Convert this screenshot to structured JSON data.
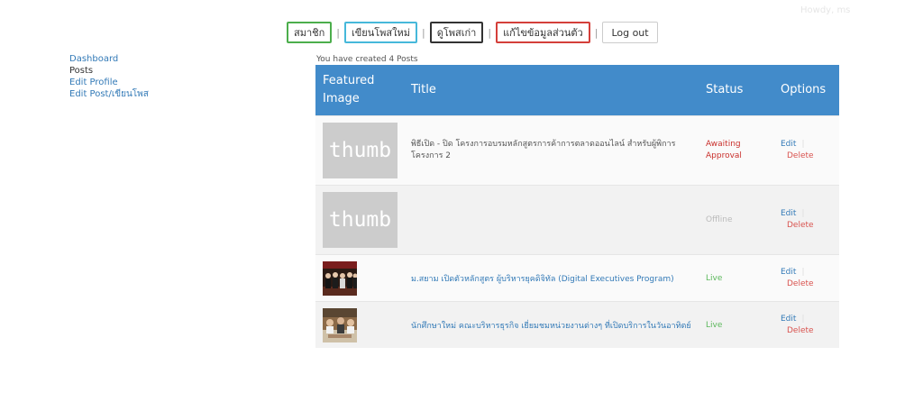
{
  "header": {
    "howdy": "Howdy, ms"
  },
  "topnav": {
    "member": "สมาชิก",
    "new_post": "เขียนโพสใหม่",
    "old_posts": "ดูโพสเก่า",
    "edit_profile": "แก้ไขข้อมูลส่วนตัว",
    "logout": "Log out",
    "separator": "|"
  },
  "sidebar": {
    "dashboard": "Dashboard",
    "posts": "Posts",
    "edit_profile": "Edit Profile",
    "edit_post": "Edit Post/เขียนโพส"
  },
  "posts": {
    "count_text": "You have created 4 Posts",
    "headers": {
      "featured_line1": "Featured",
      "featured_line2": "Image",
      "title": "Title",
      "status": "Status",
      "options": "Options"
    },
    "rows": [
      {
        "thumb": "thumb",
        "title": "พิธีเปิด - ปิด โครงการอบรมหลักสูตรการค้าการตลาดออนไลน์ สำหรับผู้พิการ โครงการ 2",
        "status_line1": "Awaiting",
        "status_line2": "Approval",
        "edit": "Edit",
        "delete": "Delete"
      },
      {
        "thumb": "thumb",
        "title": "",
        "status": "Offline",
        "edit": "Edit",
        "delete": "Delete"
      },
      {
        "image": "photo-group-stage",
        "title": "ม.สยาม เปิดตัวหลักสูตร ผู้บริหารยุคดิจิทัล (Digital Executives Program)",
        "status": "Live",
        "edit": "Edit",
        "delete": "Delete"
      },
      {
        "image": "photo-restaurant-visit",
        "title": "นักศึกษาใหม่ คณะบริหารธุรกิจ เยี่ยมชมหน่วยงานต่างๆ ที่เปิดบริการในวันอาทิตย์",
        "status": "Live",
        "edit": "Edit",
        "delete": "Delete"
      }
    ]
  },
  "colors": {
    "table_header": "#428bca",
    "link": "#337ab7",
    "live": "#5cb85c",
    "awaiting": "#c9302c",
    "delete": "#d9534f",
    "offline": "#bbbbbb"
  }
}
